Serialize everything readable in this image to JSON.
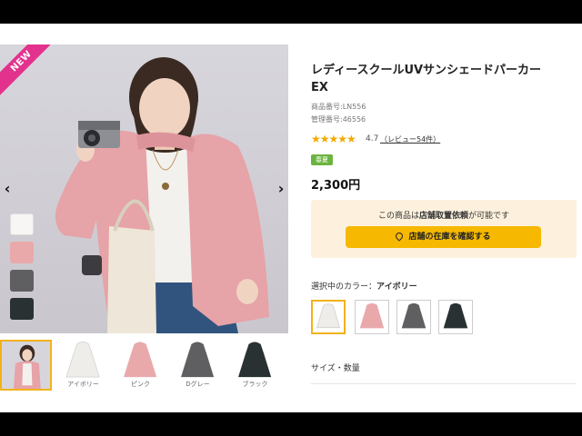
{
  "product": {
    "title": "レディースクールUVサンシェードパーカーEX",
    "item_code": "商品番号:LN556",
    "manage_code": "管理番号:46556",
    "rating": "4.7",
    "stars": "★★★★★",
    "review_link": "（レビュー54件）",
    "tag": "春夏",
    "price": "2,300円",
    "badge": "NEW"
  },
  "store": {
    "note_prefix": "この商品は",
    "note_bold": "店舗取置依頼",
    "note_suffix": "が可能です",
    "button_label": "店舗の在庫を確認する",
    "button_icon": "map-pin-icon"
  },
  "colors": {
    "label_prefix": "選択中のカラー：",
    "selected": "アイボリー"
  },
  "thumbnails": [
    "",
    "アイボリー",
    "ピンク",
    "Dグレー",
    "ブラック"
  ],
  "size_label": "サイズ・数量",
  "nav": {
    "prev": "‹",
    "next": "›"
  },
  "palette": {
    "accent": "#f2b21b",
    "ribbon": "#e3318e",
    "tag": "#6db33f",
    "swatches": [
      "#f7f6f4",
      "#e9a9ab",
      "#5f5f62",
      "#2a3133"
    ]
  }
}
